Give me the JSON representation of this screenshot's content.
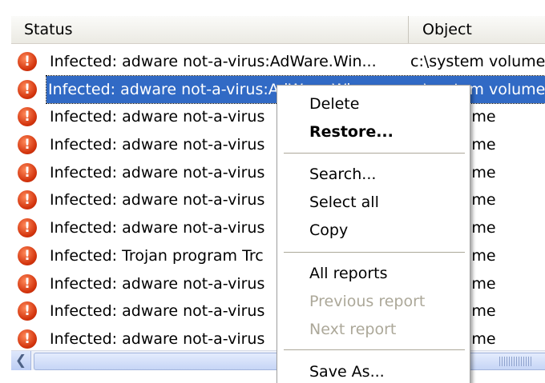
{
  "columns": {
    "status": "Status",
    "object": "Object"
  },
  "rows": [
    {
      "status": "Infected: adware not-a-virus:AdWare.Win...",
      "object": "c:\\system volume",
      "selected": false
    },
    {
      "status": "Infected: adware not-a-virus:AdWare.Win...",
      "object": "c:\\system volume",
      "selected": true
    },
    {
      "status": "Infected: adware not-a-virus",
      "object": "em volume",
      "selected": false
    },
    {
      "status": "Infected: adware not-a-virus",
      "object": "em volume",
      "selected": false
    },
    {
      "status": "Infected: adware not-a-virus",
      "object": "em volume",
      "selected": false
    },
    {
      "status": "Infected: adware not-a-virus",
      "object": "em volume",
      "selected": false
    },
    {
      "status": "Infected: adware not-a-virus",
      "object": "em volume",
      "selected": false
    },
    {
      "status": "Infected: Trojan program Trc",
      "object": "em volume",
      "selected": false
    },
    {
      "status": "Infected: adware not-a-virus",
      "object": "em volume",
      "selected": false
    },
    {
      "status": "Infected: adware not-a-virus",
      "object": "em volume",
      "selected": false
    },
    {
      "status": "Infected: adware not-a-virus",
      "object": "em volume",
      "selected": false
    }
  ],
  "row_icon": "exclamation-icon",
  "context_menu": {
    "delete": "Delete",
    "restore": "Restore...",
    "search": "Search...",
    "select_all": "Select all",
    "copy": "Copy",
    "all_reports": "All reports",
    "previous_report": "Previous report",
    "next_report": "Next report",
    "save_as": "Save As..."
  },
  "colors": {
    "selection": "#316ac5",
    "alert": "#d3340d",
    "disabled_text": "#aca899"
  }
}
